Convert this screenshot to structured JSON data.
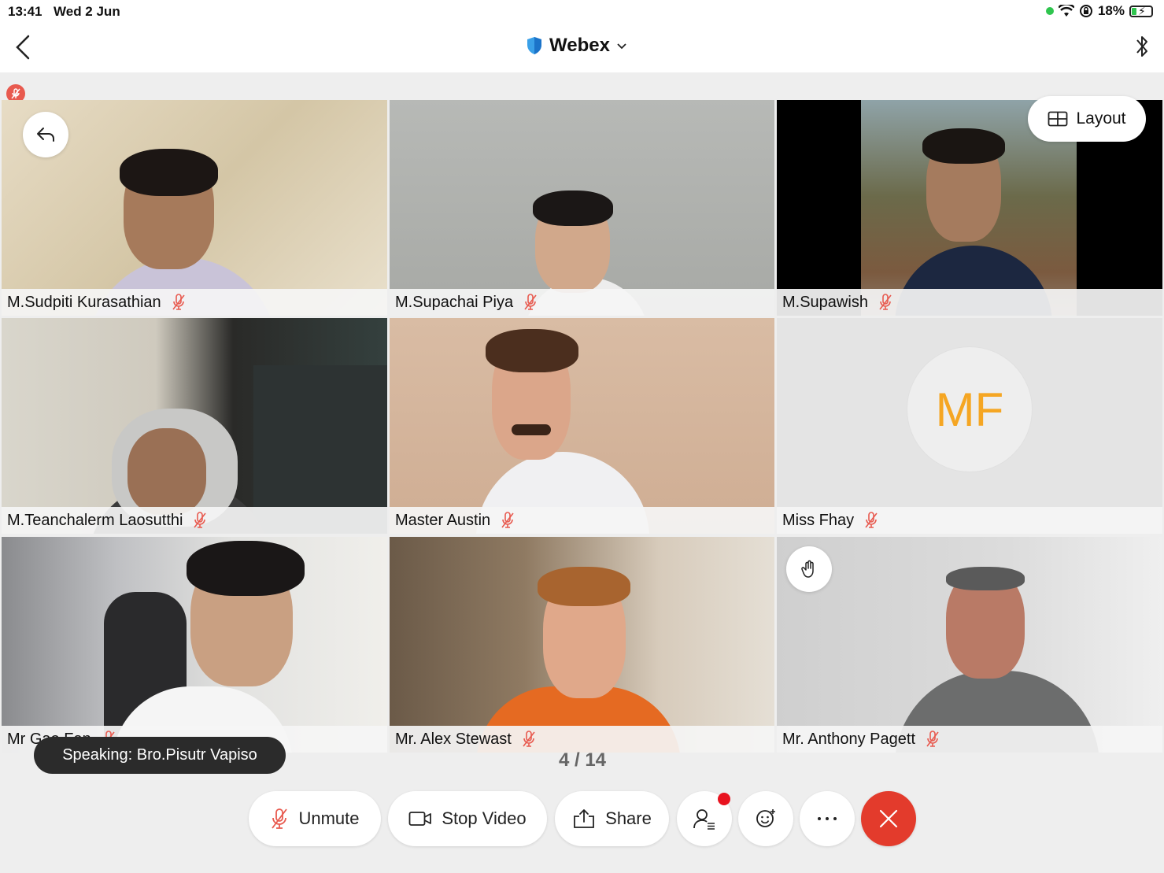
{
  "status_bar": {
    "time": "13:41",
    "date": "Wed 2 Jun",
    "battery": "18%"
  },
  "nav": {
    "title": "Webex"
  },
  "layout_button": {
    "label": "Layout"
  },
  "participants": [
    {
      "name": "M.Sudpiti Kurasathian",
      "muted": true
    },
    {
      "name": "M.Supachai Piya",
      "muted": true
    },
    {
      "name": "M.Supawish",
      "muted": true
    },
    {
      "name": "M.Teanchalerm Laosutthi",
      "muted": true
    },
    {
      "name": "Master Austin",
      "muted": true
    },
    {
      "name": "Miss Fhay",
      "muted": true,
      "initials": "MF"
    },
    {
      "name": "Mr Gao Fan",
      "muted": true
    },
    {
      "name": "Mr. Alex Stewast",
      "muted": true
    },
    {
      "name": "Mr. Anthony Pagett",
      "muted": true,
      "hand_raised": true
    }
  ],
  "speaking": "Speaking: Bro.Pisutr Vapiso",
  "pager": "4 / 14",
  "toolbar": {
    "unmute": "Unmute",
    "stop_video": "Stop Video",
    "share": "Share"
  },
  "colors": {
    "end_call": "#e33b2c",
    "muted_icon": "#e85a4f",
    "avatar_text": "#f5a623"
  }
}
